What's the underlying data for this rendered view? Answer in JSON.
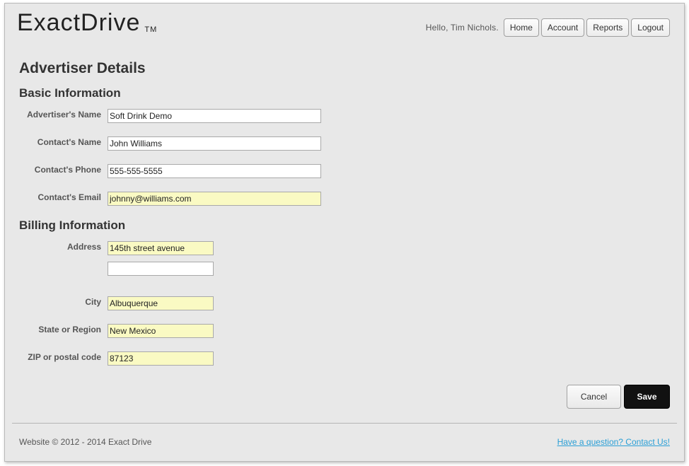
{
  "header": {
    "logo_text": "ExactDrive",
    "logo_tm": "TM",
    "greeting": "Hello, Tim Nichols.",
    "nav": [
      "Home",
      "Account",
      "Reports",
      "Logout"
    ]
  },
  "page_title": "Advertiser Details",
  "basic": {
    "title": "Basic Information",
    "fields": [
      {
        "label": "Advertiser's Name",
        "value": "Soft Drink Demo"
      },
      {
        "label": "Contact's Name",
        "value": "John Williams"
      },
      {
        "label": "Contact's Phone",
        "value": "555-555-5555"
      },
      {
        "label": "Contact's Email",
        "value": "johnny@williams.com"
      }
    ]
  },
  "billing": {
    "title": "Billing Information",
    "address_label": "Address",
    "address_line1": "145th street avenue",
    "address_line2": "",
    "city_label": "City",
    "city": "Albuquerque",
    "state_label": "State or Region",
    "state": "New Mexico",
    "zip_label": "ZIP or postal code",
    "zip": "87123"
  },
  "actions": {
    "cancel": "Cancel",
    "save": "Save"
  },
  "footer": {
    "copyright": "Website © 2012 - 2014 Exact Drive",
    "contact_link": "Have a question? Contact Us!"
  },
  "colors": {
    "frame_bg": "#e8e8e8",
    "autofill": "#fafac3",
    "save_bg": "#111111",
    "link": "#2a9fd6"
  }
}
